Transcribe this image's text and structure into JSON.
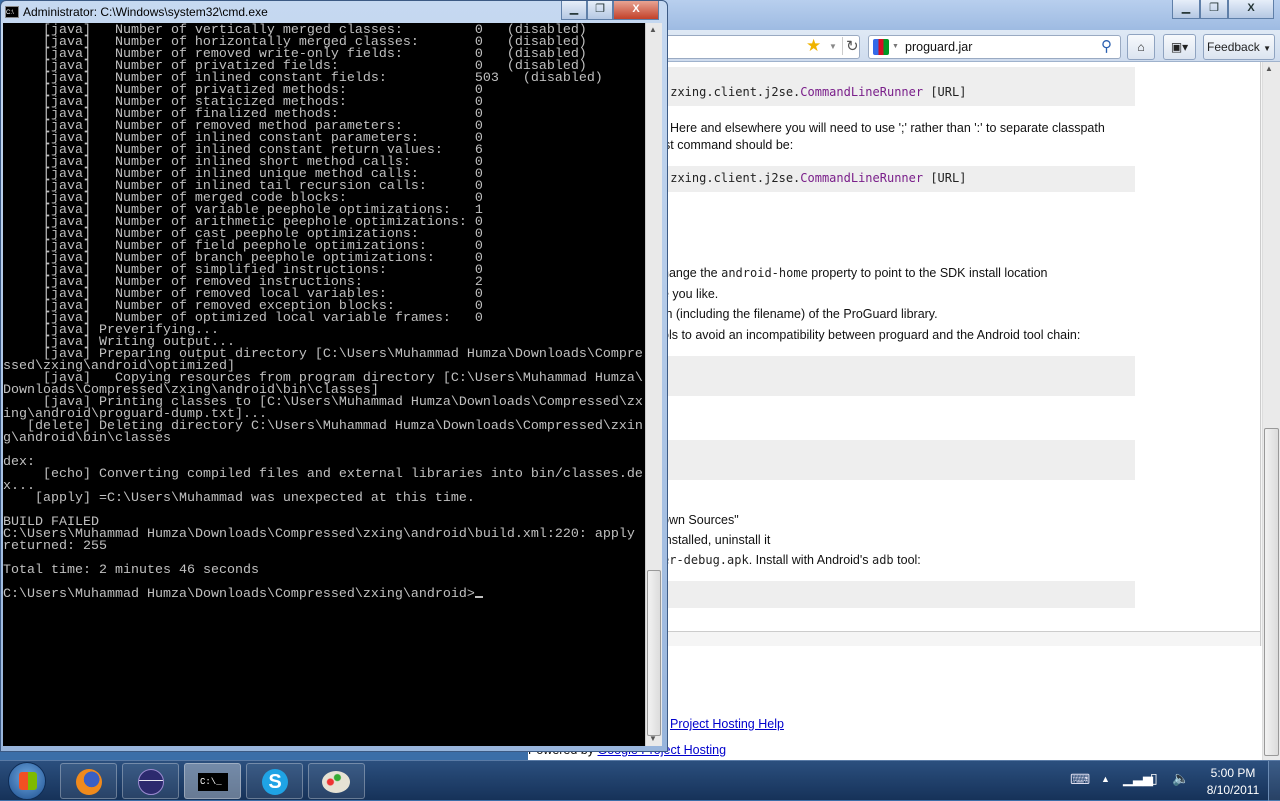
{
  "firefox": {
    "search_value": "proguard.jar",
    "feedback_label": "Feedback",
    "page": {
      "code1": {
        "prefix": ".zxing.client.j2se.",
        "cls": "CommandLineRunner",
        "suffix": " [URL]"
      },
      "para1_line1": "Here and elsewhere you will need to use ';' rather than ':' to separate classpath",
      "para1_line2": "st command should be:",
      "code2": {
        "prefix": ".zxing.client.j2se.",
        "cls": "CommandLineRunner",
        "suffix": " [URL]"
      },
      "step1_a": "hange the ",
      "step1_code": "android-home",
      "step1_b": " property to point to the SDK install location",
      "step2": "e you like.",
      "step3": "th (including the filename) of the ProGuard library.",
      "step4": "ols to avoid an incompatibility between proguard and the Android tool chain:",
      "step5": "own Sources\"",
      "step6": "installed, uninstall it",
      "step7_code": "er-debug.apk",
      "step7_a": ". Install with Android's ",
      "step7_code2": "adb",
      "step7_b": " tool:",
      "help_link": "Project Hosting Help",
      "powered_by": "Powered by ",
      "powered_link": "Google Project Hosting"
    }
  },
  "cmd": {
    "title": "Administrator: C:\\Windows\\system32\\cmd.exe",
    "stats": [
      {
        "label": "vertically merged classes:",
        "value": "0",
        "note": "(disabled)"
      },
      {
        "label": "horizontally merged classes:",
        "value": "0",
        "note": "(disabled)"
      },
      {
        "label": "removed write-only fields:",
        "value": "0",
        "note": "(disabled)"
      },
      {
        "label": "privatized fields:",
        "value": "0",
        "note": "(disabled)"
      },
      {
        "label": "inlined constant fields:",
        "value": "503",
        "note": "(disabled)"
      },
      {
        "label": "privatized methods:",
        "value": "0",
        "note": ""
      },
      {
        "label": "staticized methods:",
        "value": "0",
        "note": ""
      },
      {
        "label": "finalized methods:",
        "value": "0",
        "note": ""
      },
      {
        "label": "removed method parameters:",
        "value": "0",
        "note": ""
      },
      {
        "label": "inlined constant parameters:",
        "value": "0",
        "note": ""
      },
      {
        "label": "inlined constant return values:",
        "value": "6",
        "note": ""
      },
      {
        "label": "inlined short method calls:",
        "value": "0",
        "note": ""
      },
      {
        "label": "inlined unique method calls:",
        "value": "0",
        "note": ""
      },
      {
        "label": "inlined tail recursion calls:",
        "value": "0",
        "note": ""
      },
      {
        "label": "merged code blocks:",
        "value": "0",
        "note": ""
      },
      {
        "label": "variable peephole optimizations:",
        "value": "1",
        "note": ""
      },
      {
        "label": "arithmetic peephole optimizations:",
        "value": "0",
        "note": ""
      },
      {
        "label": "cast peephole optimizations:",
        "value": "0",
        "note": ""
      },
      {
        "label": "field peephole optimizations:",
        "value": "0",
        "note": ""
      },
      {
        "label": "branch peephole optimizations:",
        "value": "0",
        "note": ""
      },
      {
        "label": "simplified instructions:",
        "value": "0",
        "note": ""
      },
      {
        "label": "removed instructions:",
        "value": "2",
        "note": ""
      },
      {
        "label": "removed local variables:",
        "value": "0",
        "note": ""
      },
      {
        "label": "removed exception blocks:",
        "value": "0",
        "note": ""
      },
      {
        "label": "optimized local variable frames:",
        "value": "0",
        "note": ""
      }
    ],
    "stat_tag": "[java]",
    "stat_prefix": "Number of ",
    "lines": [
      "     [java] Preverifying...",
      "     [java] Writing output...",
      "     [java] Preparing output directory [C:\\Users\\Muhammad Humza\\Downloads\\Compre",
      "ssed\\zxing\\android\\optimized]",
      "     [java]   Copying resources from program directory [C:\\Users\\Muhammad Humza\\",
      "Downloads\\Compressed\\zxing\\android\\bin\\classes]",
      "     [java] Printing classes to [C:\\Users\\Muhammad Humza\\Downloads\\Compressed\\zx",
      "ing\\android\\proguard-dump.txt]...",
      "   [delete] Deleting directory C:\\Users\\Muhammad Humza\\Downloads\\Compressed\\zxin",
      "g\\android\\bin\\classes",
      "",
      "dex:",
      "     [echo] Converting compiled files and external libraries into bin/classes.de",
      "x...",
      "    [apply] =C:\\Users\\Muhammad was unexpected at this time.",
      "",
      "BUILD FAILED",
      "C:\\Users\\Muhammad Humza\\Downloads\\Compressed\\zxing\\android\\build.xml:220: apply",
      "returned: 255",
      "",
      "Total time: 2 minutes 46 seconds",
      ""
    ],
    "prompt": "C:\\Users\\Muhammad Humza\\Downloads\\Compressed\\zxing\\android>"
  },
  "taskbar": {
    "apps": [
      {
        "name": "firefox",
        "icon": "firefox-icon"
      },
      {
        "name": "eclipse",
        "icon": "eclipse-icon"
      },
      {
        "name": "cmd",
        "icon": "cmd-icon",
        "active": true,
        "label": "C:\\_"
      },
      {
        "name": "skype",
        "icon": "skype-icon",
        "label": "S"
      },
      {
        "name": "paint",
        "icon": "paint-icon"
      }
    ],
    "time": "5:00 PM",
    "date": "8/10/2011"
  },
  "colors": {
    "console_bg": "#000000",
    "console_fg": "#c0c0c0",
    "link": "#0000cc",
    "code_class": "#7a1f8a"
  }
}
